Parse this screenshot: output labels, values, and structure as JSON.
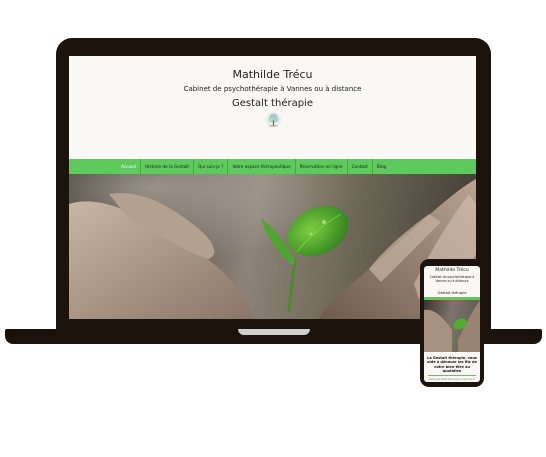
{
  "site": {
    "title": "Mathilde Trécu",
    "subtitle": "Cabinet de psychothérapie à Vannes ou à distance",
    "brand": "Gestalt thérapie"
  },
  "nav": {
    "items": [
      {
        "label": "Accueil",
        "active": true
      },
      {
        "label": "Histoire de la Gestalt",
        "active": false
      },
      {
        "label": "Qui suis-je ?",
        "active": false
      },
      {
        "label": "Votre espace thérapeutique",
        "active": false
      },
      {
        "label": "Réservation en ligne",
        "active": false
      },
      {
        "label": "Contact",
        "active": false
      },
      {
        "label": "Blog",
        "active": false
      }
    ]
  },
  "phone": {
    "title": "Mathilde Trécu",
    "sub": "Cabinet de psychothérapie à Vannes ou à distance",
    "brand": "Gestalt thérapie",
    "caption": "La Gestalt thérapie, vous aide à dénouer les fils de votre bien-être au quotidien",
    "url": "www.gestalt-therapie-vannes.fr"
  },
  "colors": {
    "nav_green": "#5ec95c",
    "device_frame": "#1c130c",
    "page_bg": "#faf8f4"
  }
}
